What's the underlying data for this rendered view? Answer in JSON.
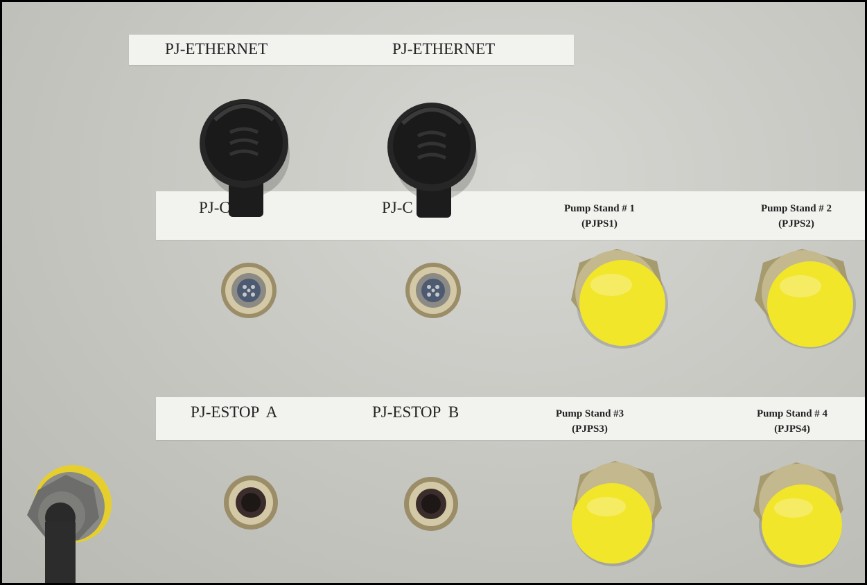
{
  "labels": {
    "ethernet_1": "PJ-ETHERNET",
    "ethernet_2": "PJ-ETHERNET",
    "pjc_1": "PJ-C",
    "pjc_2": "PJ-C",
    "estop_a": "PJ-ESTOP  A",
    "estop_b": "PJ-ESTOP  B",
    "pump_stand_1": {
      "name": "Pump Stand # 1",
      "code": "(PJPS1)"
    },
    "pump_stand_2": {
      "name": "Pump Stand # 2",
      "code": "(PJPS2)"
    },
    "pump_stand_3": {
      "name": "Pump Stand #3",
      "code": "(PJPS3)"
    },
    "pump_stand_4": {
      "name": "Pump Stand # 4",
      "code": "(PJPS4)"
    }
  },
  "colors": {
    "panel": "#c9c9c4",
    "label_tape": "#f2f2ef",
    "cap_yellow": "#f2e62a",
    "ethernet_cap": "#1f1f1f",
    "connector_metal": "#b9ab84",
    "gland_gray": "#6d6d6b"
  },
  "icons": {
    "ethernet_caps": "ethernet-cap-icon",
    "round_connectors": "m12-connector-icon",
    "pump_caps": "yellow-dust-cap-icon",
    "cable_gland": "cable-gland-icon"
  }
}
